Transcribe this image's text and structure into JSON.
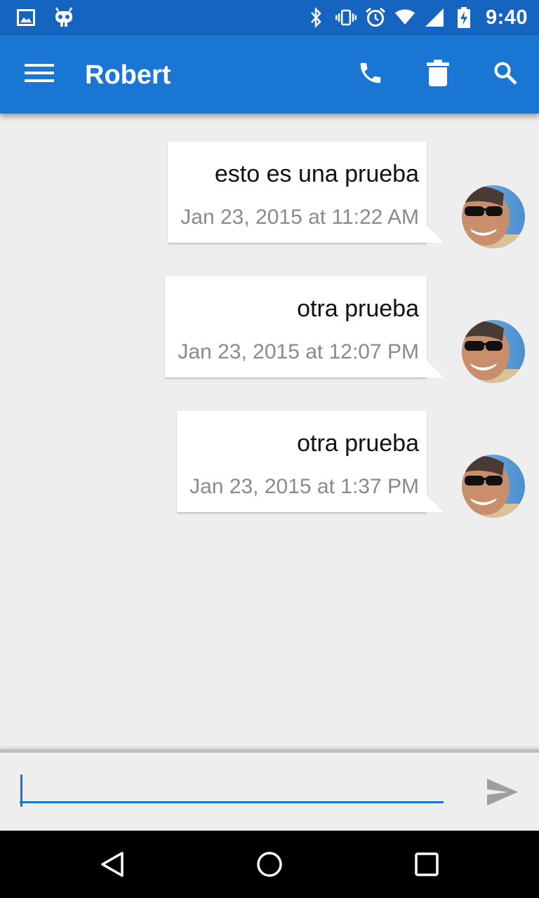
{
  "status_bar": {
    "time": "9:40",
    "left_icons": [
      "image-notification-icon",
      "cyanogenmod-icon"
    ],
    "right_icons": [
      "bluetooth-icon",
      "vibrate-icon",
      "alarm-icon",
      "wifi-icon",
      "signal-icon",
      "battery-charging-icon"
    ]
  },
  "app_bar": {
    "title": "Robert",
    "menu_icon": "menu-icon",
    "actions": [
      "call-icon",
      "delete-icon",
      "search-icon"
    ]
  },
  "messages": [
    {
      "text": "esto es una prueba",
      "timestamp": "Jan 23, 2015 at 11:22 AM"
    },
    {
      "text": "otra prueba",
      "timestamp": "Jan 23, 2015 at 12:07 PM"
    },
    {
      "text": "otra prueba",
      "timestamp": "Jan 23, 2015 at 1:37 PM"
    }
  ],
  "compose": {
    "value": "",
    "send_icon": "send-icon"
  },
  "nav_bar": {
    "buttons": [
      "back-icon",
      "home-icon",
      "recents-icon"
    ]
  },
  "colors": {
    "status_bar": "#1565c0",
    "app_bar": "#1976d2",
    "background": "#eeeeee",
    "bubble": "#ffffff",
    "timestamp": "#8a8a8a"
  }
}
